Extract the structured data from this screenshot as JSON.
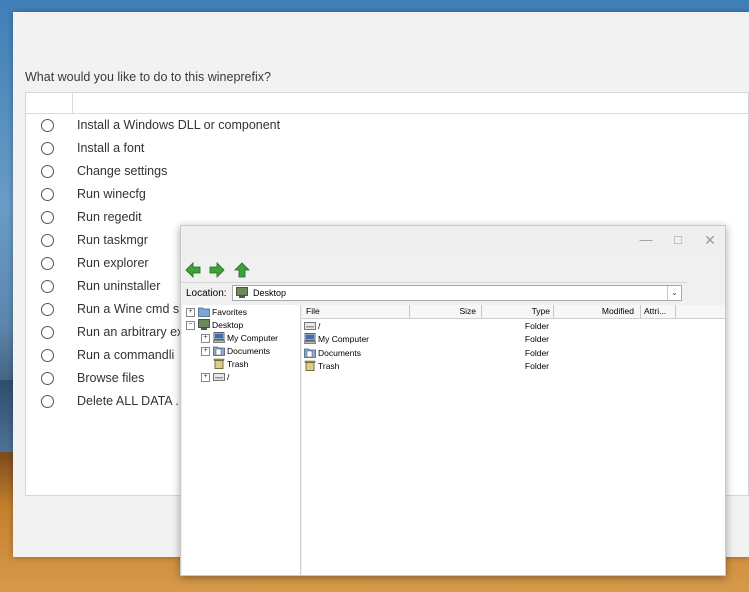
{
  "main_window": {
    "prompt": "What would you like to do to this wineprefix?",
    "options": [
      {
        "label": "Install a Windows DLL or component"
      },
      {
        "label": "Install a font"
      },
      {
        "label": "Change settings"
      },
      {
        "label": "Run winecfg"
      },
      {
        "label": "Run regedit"
      },
      {
        "label": "Run taskmgr"
      },
      {
        "label": "Run explorer"
      },
      {
        "label": "Run uninstaller"
      },
      {
        "label": "Run a Wine cmd s"
      },
      {
        "label": "Run an arbitrary ex"
      },
      {
        "label": "Run a commandli"
      },
      {
        "label": "Browse files"
      },
      {
        "label": "Delete ALL DATA ."
      }
    ]
  },
  "file_browser": {
    "window_controls": {
      "minimize": "—",
      "maximize": "□",
      "close": "✕"
    },
    "toolbar": [
      "back-icon",
      "forward-icon",
      "up-icon"
    ],
    "location_label": "Location:",
    "location_value": "Desktop",
    "tree": [
      {
        "label": "Favorites",
        "expander": "+",
        "icon": "folder-icon"
      },
      {
        "label": "Desktop",
        "expander": "−",
        "icon": "desktop-icon"
      },
      {
        "label": "My Computer",
        "expander": "+",
        "icon": "computer-icon"
      },
      {
        "label": "Documents",
        "expander": "+",
        "icon": "documents-icon"
      },
      {
        "label": "Trash",
        "expander": "",
        "icon": "trash-icon"
      },
      {
        "label": "/",
        "expander": "+",
        "icon": "drive-icon"
      }
    ],
    "columns": [
      "File",
      "Size",
      "Type",
      "Modified",
      "Attri..."
    ],
    "files": [
      {
        "name": "/",
        "type": "Folder",
        "icon": "drive-icon"
      },
      {
        "name": "My Computer",
        "type": "Folder",
        "icon": "computer-icon"
      },
      {
        "name": "Documents",
        "type": "Folder",
        "icon": "documents-icon"
      },
      {
        "name": "Trash",
        "type": "Folder",
        "icon": "trash-icon"
      }
    ]
  }
}
